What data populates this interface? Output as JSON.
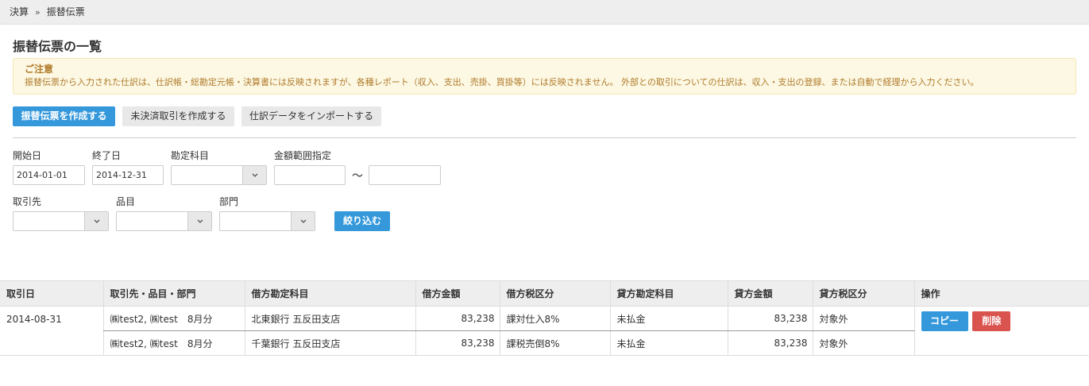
{
  "breadcrumb": {
    "items": [
      "決算",
      "振替伝票"
    ],
    "separator": "»"
  },
  "page": {
    "title": "振替伝票の一覧"
  },
  "notice": {
    "title": "ご注意",
    "body": "振替伝票から入力された仕訳は、仕訳帳・総勘定元帳・決算書には反映されますが、各種レポート（収入、支出、売掛、買掛等）には反映されません。 外部との取引についての仕訳は、収入・支出の登録、または自動で経理から入力ください。"
  },
  "toolbar": {
    "create_label": "振替伝票を作成する",
    "unsettled_label": "未決済取引を作成する",
    "import_label": "仕訳データをインポートする"
  },
  "filters": {
    "start_date_label": "開始日",
    "start_date_value": "2014-01-01",
    "end_date_label": "終了日",
    "end_date_value": "2014-12-31",
    "account_label": "勘定科目",
    "amount_range_label": "金額範囲指定",
    "range_separator": "〜",
    "partner_label": "取引先",
    "item_label": "品目",
    "department_label": "部門",
    "submit_label": "絞り込む"
  },
  "table": {
    "headers": [
      "取引日",
      "取引先・品目・部門",
      "借方勘定科目",
      "借方金額",
      "借方税区分",
      "貸方勘定科目",
      "貸方金額",
      "貸方税区分",
      "操作"
    ],
    "entries": [
      {
        "date": "2014-08-31",
        "lines": [
          {
            "partner": "㈱test2, ㈱test　8月分",
            "debit_account": "北東銀行 五反田支店",
            "debit_amount": "83,238",
            "debit_tax": "課対仕入8%",
            "credit_account": "未払金",
            "credit_amount": "83,238",
            "credit_tax": "対象外"
          },
          {
            "partner": "㈱test2, ㈱test　8月分",
            "debit_account": "千葉銀行 五反田支店",
            "debit_amount": "83,238",
            "debit_tax": "課税売倒8%",
            "credit_account": "未払金",
            "credit_amount": "83,238",
            "credit_tax": "対象外"
          }
        ],
        "copy_label": "コピー",
        "delete_label": "削除"
      }
    ]
  },
  "colors": {
    "primary": "#3498db",
    "danger": "#d9534f",
    "notice_bg": "#fcf8e3",
    "notice_text": "#b07a2a"
  },
  "icons": {
    "select_arrow": "chevron-down-icon"
  }
}
